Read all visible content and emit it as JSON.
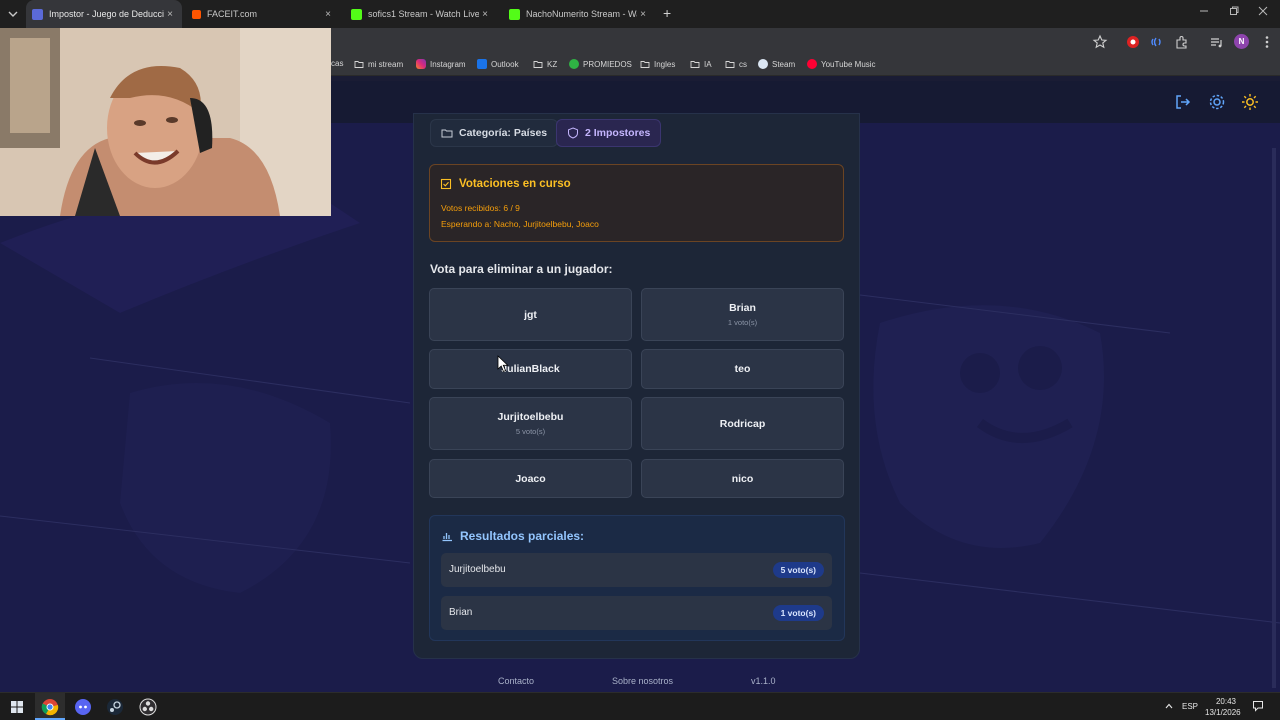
{
  "browser": {
    "tabs": [
      {
        "label": "Impostor - Juego de Deducción",
        "active": true,
        "icon_color": "#5b6ad8"
      },
      {
        "label": "FACEIT.com",
        "active": false,
        "icon_color": "#ff5500"
      },
      {
        "label": "sofics1 Stream - Watch Live on",
        "active": false,
        "icon_color": "#53fc18"
      },
      {
        "label": "NachoNumerito Stream - Watch",
        "active": false,
        "icon_color": "#53fc18"
      }
    ],
    "close_glyph": "×",
    "newtab_glyph": "+",
    "bookmarks": [
      {
        "label": "cas",
        "icon": "none"
      },
      {
        "label": "mi stream",
        "icon": "folder-icon"
      },
      {
        "label": "Instagram",
        "icon": "instagram-icon"
      },
      {
        "label": "Outlook",
        "icon": "outlook-icon"
      },
      {
        "label": "KZ",
        "icon": "folder-icon"
      },
      {
        "label": "PROMIEDOS",
        "icon": "promiedos-icon"
      },
      {
        "label": "Ingles",
        "icon": "folder-icon"
      },
      {
        "label": "IA",
        "icon": "folder-icon"
      },
      {
        "label": "cs",
        "icon": "folder-icon"
      },
      {
        "label": "Steam",
        "icon": "steam-icon"
      },
      {
        "label": "YouTube Music",
        "icon": "youtube-music-icon"
      }
    ],
    "profile_initial": "N"
  },
  "game": {
    "category_chip": "Categoría: Países",
    "impostors_chip": "2 Impostores",
    "voting": {
      "title": "Votaciones en curso",
      "received": "Votos recibidos: 6 / 9",
      "waiting": "Esperando a: Nacho, Jurjitoelbebu, Joaco"
    },
    "vote_heading": "Vota para eliminar a un jugador:",
    "players": [
      {
        "name": "jgt",
        "votes": ""
      },
      {
        "name": "Brian",
        "votes": "1 voto(s)"
      },
      {
        "name": "JulianBlack",
        "votes": ""
      },
      {
        "name": "teo",
        "votes": ""
      },
      {
        "name": "Jurjitoelbebu",
        "votes": "5 voto(s)"
      },
      {
        "name": "Rodricap",
        "votes": ""
      },
      {
        "name": "Joaco",
        "votes": ""
      },
      {
        "name": "nico",
        "votes": ""
      }
    ],
    "results": {
      "title": "Resultados parciales:",
      "rows": [
        {
          "name": "Jurjitoelbebu",
          "votes": "5 voto(s)"
        },
        {
          "name": "Brian",
          "votes": "1 voto(s)"
        }
      ]
    }
  },
  "footer": {
    "contact": "Contacto",
    "about": "Sobre nosotros",
    "version": "v1.1.0"
  },
  "taskbar": {
    "language": "ESP",
    "time": "20:43",
    "date": "13/1/2026"
  },
  "colors": {
    "accent_blue": "#60a5fa",
    "warning_amber": "#fbbf24",
    "impostor_purple": "#c4b5fd",
    "page_bg": "#1b1c4a"
  }
}
